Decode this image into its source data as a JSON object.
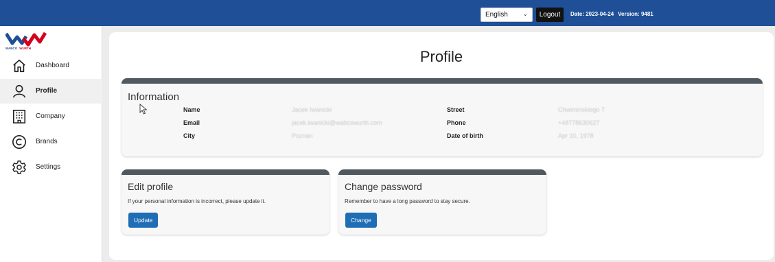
{
  "header": {
    "language": "English",
    "logout_label": "Logout",
    "date_label": "Date: 2023-04-24",
    "version_label": "Version: 9481",
    "brand_color": "#1e4f97"
  },
  "logo": {
    "brand_left": "WABCO",
    "brand_right": "WÜRTH"
  },
  "sidebar": {
    "items": [
      {
        "label": "Dashboard",
        "icon": "home-icon"
      },
      {
        "label": "Profile",
        "icon": "user-icon",
        "active": true
      },
      {
        "label": "Company",
        "icon": "building-icon"
      },
      {
        "label": "Brands",
        "icon": "copyright-icon"
      },
      {
        "label": "Settings",
        "icon": "gear-icon"
      }
    ]
  },
  "page": {
    "title": "Profile"
  },
  "information": {
    "title": "Information",
    "fields": {
      "name": {
        "label": "Name",
        "value": "Jacek Iwanicki"
      },
      "email": {
        "label": "Email",
        "value": "jacek.iwanicki@wabcowurth.com"
      },
      "city": {
        "label": "City",
        "value": "Poznan"
      },
      "street": {
        "label": "Street",
        "value": "Chwiminskiego 7"
      },
      "phone": {
        "label": "Phone",
        "value": "+48778630627"
      },
      "dob": {
        "label": "Date of birth",
        "value": "Apr 10, 1978"
      }
    }
  },
  "edit_profile": {
    "title": "Edit profile",
    "description": "If your personal information is incorrect, please update it.",
    "button": "Update"
  },
  "change_password": {
    "title": "Change password",
    "description": "Remember to have a long password to stay secure.",
    "button": "Change"
  },
  "colors": {
    "accent_button": "#1f6db5",
    "card_bar": "#505860"
  }
}
